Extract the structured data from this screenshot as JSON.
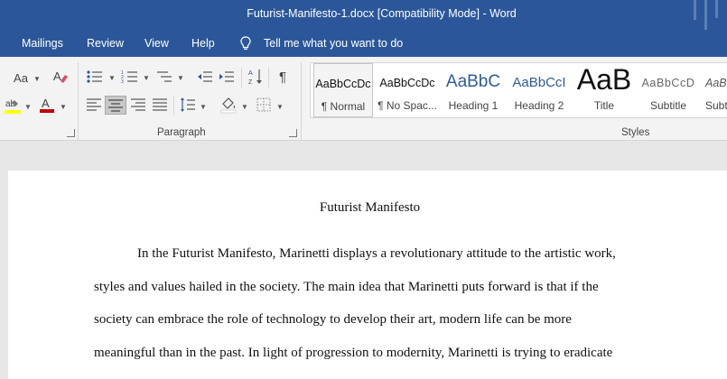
{
  "window": {
    "title": "Futurist-Manifesto-1.docx [Compatibility Mode]  -  Word"
  },
  "menu": {
    "items": [
      "Mailings",
      "Review",
      "View",
      "Help"
    ],
    "tell_me": "Tell me what you want to do"
  },
  "ribbon": {
    "font_size_label": "Aa",
    "paragraph_group": "Paragraph",
    "styles_group": "Styles",
    "styles": [
      {
        "preview": "AaBbCcDc",
        "name": "¶ Normal"
      },
      {
        "preview": "AaBbCcDc",
        "name": "¶ No Spac..."
      },
      {
        "preview": "AaBbC",
        "name": "Heading 1"
      },
      {
        "preview": "AaBbCcI",
        "name": "Heading 2"
      },
      {
        "preview": "AaB",
        "name": "Title"
      },
      {
        "preview": "AaBbCcD",
        "name": "Subtitle"
      },
      {
        "preview": "AaBl",
        "name": "Subt"
      }
    ],
    "colors": {
      "highlight": "#ffff00",
      "font_color": "#c00000",
      "accent": "#2b579a"
    }
  },
  "document": {
    "title": "Futurist Manifesto",
    "lines": [
      "In the Futurist Manifesto, Marinetti displays a revolutionary attitude to the artistic work,",
      "styles and values hailed in the society. The main idea that Marinetti puts forward is that if the",
      "society can embrace the role of technology to develop their art, modern life can be more",
      "meaningful than in the past. In light of progression to modernity, Marinetti is trying to eradicate"
    ]
  }
}
